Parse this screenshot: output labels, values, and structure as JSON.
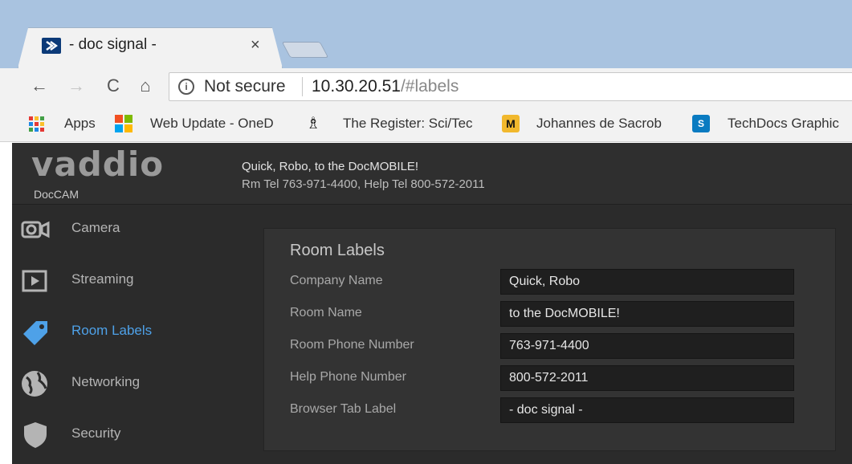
{
  "browser": {
    "tab": {
      "title": "- doc signal -",
      "close": "×"
    },
    "nav": {
      "back": "←",
      "forward": "→",
      "reload": "C",
      "home": "⌂"
    },
    "omnibox": {
      "security_label": "Not secure",
      "url_host": "10.30.20.51",
      "url_path": "/#labels"
    },
    "bookmarks": [
      {
        "label": "Apps",
        "icon": "apps-grid-icon"
      },
      {
        "label": "Web Update - OneD",
        "icon": "windows-logo-icon"
      },
      {
        "label": "The Register: Sci/Tec",
        "icon": "the-register-icon"
      },
      {
        "label": "Johannes de Sacrob",
        "icon": "mizzou-logo-icon"
      },
      {
        "label": "TechDocs Graphic",
        "icon": "sharepoint-icon"
      }
    ]
  },
  "app": {
    "brand": "vaddio",
    "product": "DocCAM",
    "header": {
      "line1": "Quick, Robo, to the DocMOBILE!",
      "line2": "Rm Tel 763-971-4400, Help Tel 800-572-2011"
    },
    "sidebar": {
      "items": [
        {
          "label": "Camera",
          "icon": "camera-icon",
          "active": false
        },
        {
          "label": "Streaming",
          "icon": "streaming-play-icon",
          "active": false
        },
        {
          "label": "Room Labels",
          "icon": "tag-label-icon",
          "active": true
        },
        {
          "label": "Networking",
          "icon": "globe-icon",
          "active": false
        },
        {
          "label": "Security",
          "icon": "shield-icon",
          "active": false
        }
      ]
    },
    "room_labels": {
      "title": "Room Labels",
      "fields": [
        {
          "label": "Company Name",
          "value": "Quick, Robo"
        },
        {
          "label": "Room Name",
          "value": "to the DocMOBILE!"
        },
        {
          "label": "Room Phone Number",
          "value": "763-971-4400"
        },
        {
          "label": "Help Phone Number",
          "value": "800-572-2011"
        },
        {
          "label": "Browser Tab Label",
          "value": "- doc signal -"
        }
      ]
    }
  },
  "colors": {
    "tabstrip": "#a9c3e0",
    "chrome": "#f2f2f2",
    "page_bg": "#2b2b2b",
    "panel_bg": "#333333",
    "active_nav": "#4ea1e8",
    "input_bg": "#1f1f1f"
  }
}
